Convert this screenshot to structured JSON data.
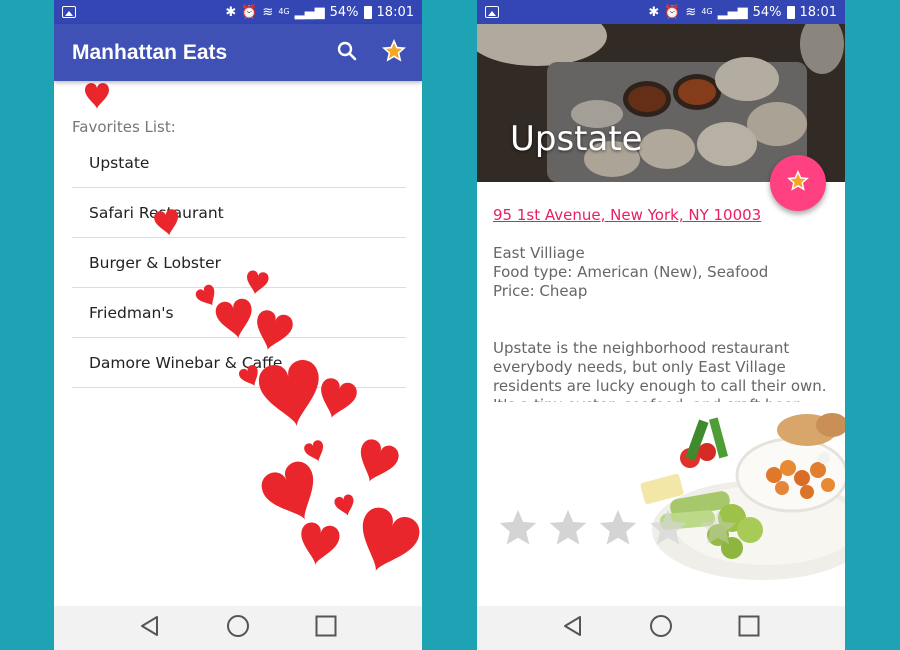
{
  "status_bar": {
    "battery": "54%",
    "time": "18:01",
    "network": "4G"
  },
  "left_screen": {
    "app_title": "Manhattan Eats",
    "favorites_label": "Favorites List:",
    "favorites": [
      {
        "name": "Upstate"
      },
      {
        "name": "Safari Restaurant"
      },
      {
        "name": "Burger & Lobster"
      },
      {
        "name": "Friedman's"
      },
      {
        "name": "Damore Winebar & Caffe"
      }
    ]
  },
  "right_screen": {
    "restaurant_name": "Upstate",
    "address": "95 1st Avenue, New York, NY  10003",
    "neighborhood": "East Villiage",
    "food_type": "Food type: American (New), Seafood",
    "price": "Price: Cheap",
    "description": "Upstate is the neighborhood restaurant everybody needs, but only East Village residents are lucky enough to call their own. It's a tiny oyster, seafood, and craft beer",
    "rating": 0,
    "rating_max": 5
  },
  "icons": {
    "search": "search-icon",
    "favorites": "star-icon",
    "fab": "star-icon",
    "nav_back": "back-triangle-icon",
    "nav_home": "home-circle-icon",
    "nav_recents": "recents-square-icon"
  },
  "colors": {
    "app_bar": "#3f51b5",
    "status_bar": "#3346b4",
    "accent": "#ff4081",
    "hearts": "#e8262b",
    "background": "#1ea3b5"
  }
}
